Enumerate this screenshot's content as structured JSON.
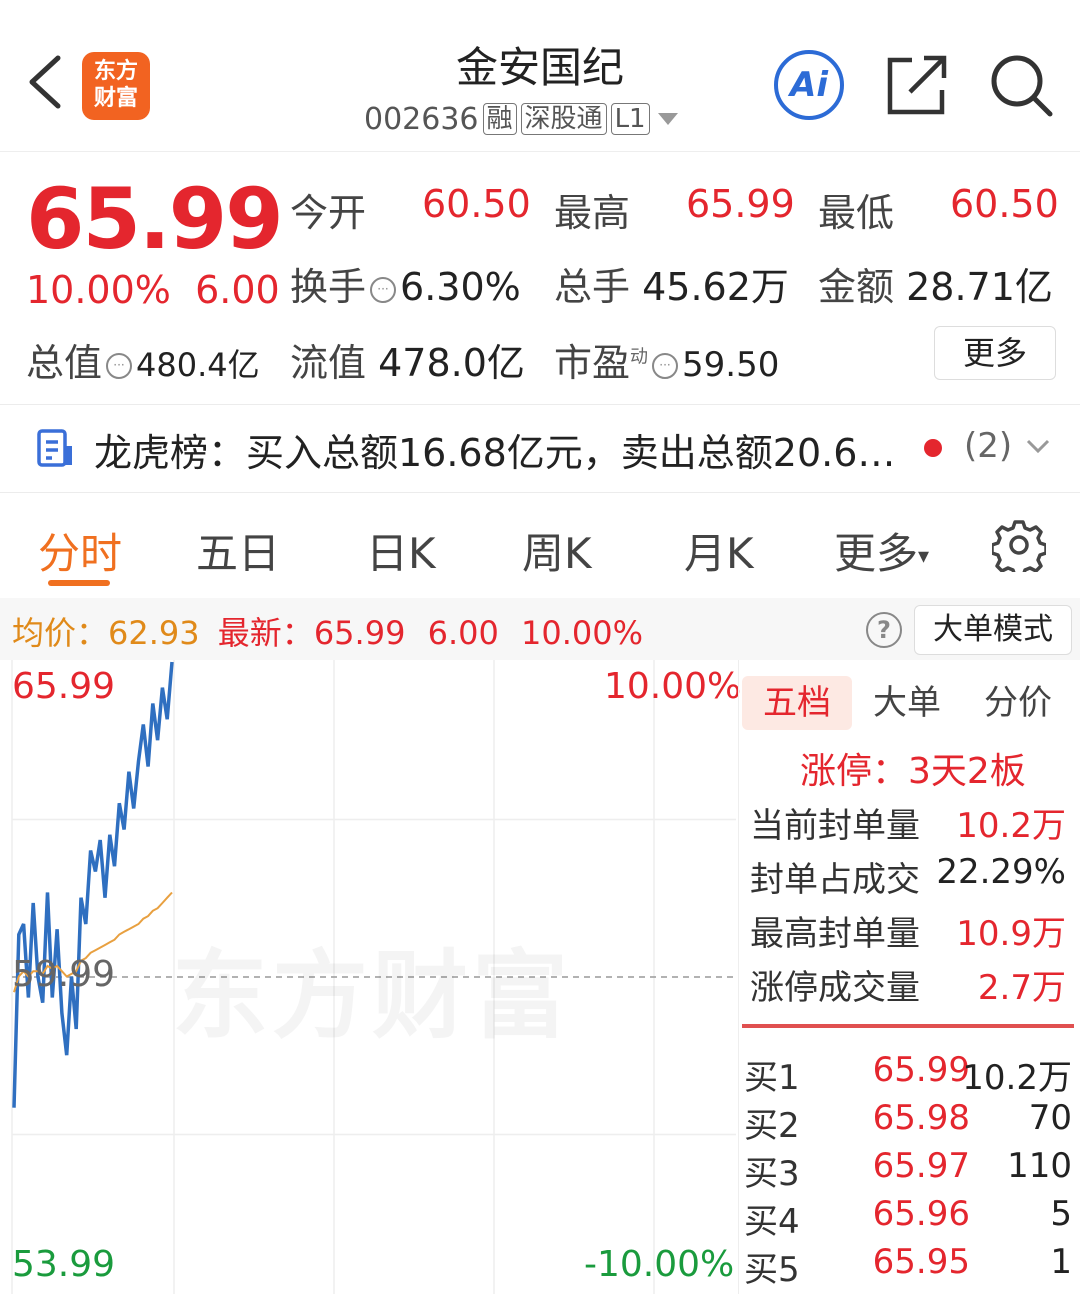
{
  "header": {
    "logo_line1": "东方",
    "logo_line2": "财富",
    "title": "金安国纪",
    "code": "002636",
    "tags": [
      "融",
      "深股通",
      "L1"
    ],
    "ai_label": "Ai"
  },
  "quote": {
    "price": "65.99",
    "change_pct": "10.00%",
    "change": "6.00",
    "open_label": "今开",
    "open": "60.50",
    "high_label": "最高",
    "high": "65.99",
    "low_label": "最低",
    "low": "60.50",
    "turnover_label": "换手",
    "turnover": "6.30%",
    "volume_label": "总手",
    "volume": "45.62万",
    "amount_label": "金额",
    "amount": "28.71亿",
    "mktcap_label": "总值",
    "mktcap": "480.4亿",
    "float_label": "流值",
    "float": "478.0亿",
    "pe_label": "市盈",
    "pe_sup": "动",
    "pe": "59.50",
    "more": "更多"
  },
  "dragon_tiger": {
    "text": "龙虎榜：买入总额16.68亿元，卖出总额20.6…",
    "count": "(2)"
  },
  "tabs": [
    "分时",
    "五日",
    "日K",
    "周K",
    "月K",
    "更多"
  ],
  "avg_bar": {
    "avg_label": "均价：",
    "avg": "62.93",
    "latest_label": "最新：",
    "latest": "65.99",
    "change": "6.00",
    "change_pct": "10.00%",
    "big_order_mode": "大单模式"
  },
  "chart": {
    "y_top": "65.99",
    "y_mid": "59.99",
    "y_bot": "53.99",
    "pct_top": "10.00%",
    "pct_bot": "-10.00%",
    "watermark": "东方财富"
  },
  "chart_data": {
    "type": "line",
    "ylim": [
      53.99,
      65.99
    ],
    "prev_close": 59.99,
    "series": [
      {
        "values": [
          57.5,
          60.8,
          61.0,
          59.6,
          61.4,
          60.0,
          59.5,
          61.6,
          59.6,
          60.9,
          59.3,
          58.5,
          60.0,
          59.0,
          61.5,
          61.0,
          62.4,
          62.0,
          62.6,
          61.5,
          62.7,
          62.1,
          63.3,
          62.8,
          63.9,
          63.2,
          64.1,
          64.8,
          64.0,
          65.2,
          64.5,
          65.5,
          64.9,
          65.99
        ]
      },
      {
        "values": [
          59.7,
          60.0,
          60.1,
          60.0,
          60.1,
          60.1,
          60.05,
          60.2,
          60.15,
          60.2,
          60.1,
          60.0,
          60.05,
          60.1,
          60.3,
          60.35,
          60.45,
          60.5,
          60.55,
          60.6,
          60.65,
          60.7,
          60.8,
          60.85,
          60.9,
          60.95,
          61.0,
          61.1,
          61.15,
          61.25,
          61.3,
          61.4,
          61.5,
          61.6
        ]
      }
    ]
  },
  "right_panel": {
    "tabs": [
      "五档",
      "大单",
      "分价"
    ],
    "limit_label": "涨停：3天2板",
    "stats": [
      {
        "label": "当前封单量",
        "value": "10.2万"
      },
      {
        "label": "封单占成交",
        "value": "22.29%"
      },
      {
        "label": "最高封单量",
        "value": "10.9万"
      },
      {
        "label": "涨停成交量",
        "value": "2.7万"
      }
    ],
    "bids": [
      {
        "label": "买1",
        "price": "65.99",
        "vol": "10.2万"
      },
      {
        "label": "买2",
        "price": "65.98",
        "vol": "70"
      },
      {
        "label": "买3",
        "price": "65.97",
        "vol": "110"
      },
      {
        "label": "买4",
        "price": "65.96",
        "vol": "5"
      },
      {
        "label": "买5",
        "price": "65.95",
        "vol": "1"
      }
    ]
  }
}
